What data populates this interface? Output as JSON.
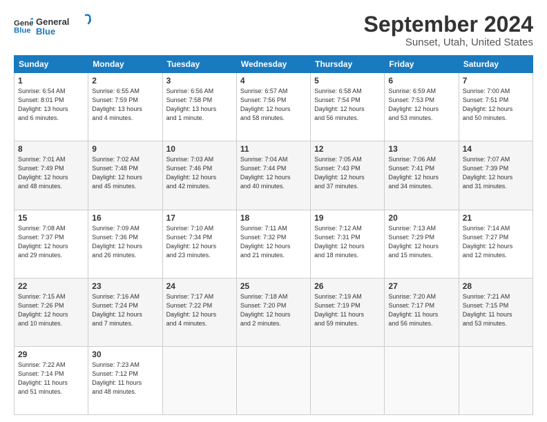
{
  "header": {
    "logo_line1": "General",
    "logo_line2": "Blue",
    "month": "September 2024",
    "location": "Sunset, Utah, United States"
  },
  "weekdays": [
    "Sunday",
    "Monday",
    "Tuesday",
    "Wednesday",
    "Thursday",
    "Friday",
    "Saturday"
  ],
  "weeks": [
    [
      {
        "day": "1",
        "info": "Sunrise: 6:54 AM\nSunset: 8:01 PM\nDaylight: 13 hours\nand 6 minutes."
      },
      {
        "day": "2",
        "info": "Sunrise: 6:55 AM\nSunset: 7:59 PM\nDaylight: 13 hours\nand 4 minutes."
      },
      {
        "day": "3",
        "info": "Sunrise: 6:56 AM\nSunset: 7:58 PM\nDaylight: 13 hours\nand 1 minute."
      },
      {
        "day": "4",
        "info": "Sunrise: 6:57 AM\nSunset: 7:56 PM\nDaylight: 12 hours\nand 58 minutes."
      },
      {
        "day": "5",
        "info": "Sunrise: 6:58 AM\nSunset: 7:54 PM\nDaylight: 12 hours\nand 56 minutes."
      },
      {
        "day": "6",
        "info": "Sunrise: 6:59 AM\nSunset: 7:53 PM\nDaylight: 12 hours\nand 53 minutes."
      },
      {
        "day": "7",
        "info": "Sunrise: 7:00 AM\nSunset: 7:51 PM\nDaylight: 12 hours\nand 50 minutes."
      }
    ],
    [
      {
        "day": "8",
        "info": "Sunrise: 7:01 AM\nSunset: 7:49 PM\nDaylight: 12 hours\nand 48 minutes."
      },
      {
        "day": "9",
        "info": "Sunrise: 7:02 AM\nSunset: 7:48 PM\nDaylight: 12 hours\nand 45 minutes."
      },
      {
        "day": "10",
        "info": "Sunrise: 7:03 AM\nSunset: 7:46 PM\nDaylight: 12 hours\nand 42 minutes."
      },
      {
        "day": "11",
        "info": "Sunrise: 7:04 AM\nSunset: 7:44 PM\nDaylight: 12 hours\nand 40 minutes."
      },
      {
        "day": "12",
        "info": "Sunrise: 7:05 AM\nSunset: 7:43 PM\nDaylight: 12 hours\nand 37 minutes."
      },
      {
        "day": "13",
        "info": "Sunrise: 7:06 AM\nSunset: 7:41 PM\nDaylight: 12 hours\nand 34 minutes."
      },
      {
        "day": "14",
        "info": "Sunrise: 7:07 AM\nSunset: 7:39 PM\nDaylight: 12 hours\nand 31 minutes."
      }
    ],
    [
      {
        "day": "15",
        "info": "Sunrise: 7:08 AM\nSunset: 7:37 PM\nDaylight: 12 hours\nand 29 minutes."
      },
      {
        "day": "16",
        "info": "Sunrise: 7:09 AM\nSunset: 7:36 PM\nDaylight: 12 hours\nand 26 minutes."
      },
      {
        "day": "17",
        "info": "Sunrise: 7:10 AM\nSunset: 7:34 PM\nDaylight: 12 hours\nand 23 minutes."
      },
      {
        "day": "18",
        "info": "Sunrise: 7:11 AM\nSunset: 7:32 PM\nDaylight: 12 hours\nand 21 minutes."
      },
      {
        "day": "19",
        "info": "Sunrise: 7:12 AM\nSunset: 7:31 PM\nDaylight: 12 hours\nand 18 minutes."
      },
      {
        "day": "20",
        "info": "Sunrise: 7:13 AM\nSunset: 7:29 PM\nDaylight: 12 hours\nand 15 minutes."
      },
      {
        "day": "21",
        "info": "Sunrise: 7:14 AM\nSunset: 7:27 PM\nDaylight: 12 hours\nand 12 minutes."
      }
    ],
    [
      {
        "day": "22",
        "info": "Sunrise: 7:15 AM\nSunset: 7:26 PM\nDaylight: 12 hours\nand 10 minutes."
      },
      {
        "day": "23",
        "info": "Sunrise: 7:16 AM\nSunset: 7:24 PM\nDaylight: 12 hours\nand 7 minutes."
      },
      {
        "day": "24",
        "info": "Sunrise: 7:17 AM\nSunset: 7:22 PM\nDaylight: 12 hours\nand 4 minutes."
      },
      {
        "day": "25",
        "info": "Sunrise: 7:18 AM\nSunset: 7:20 PM\nDaylight: 12 hours\nand 2 minutes."
      },
      {
        "day": "26",
        "info": "Sunrise: 7:19 AM\nSunset: 7:19 PM\nDaylight: 11 hours\nand 59 minutes."
      },
      {
        "day": "27",
        "info": "Sunrise: 7:20 AM\nSunset: 7:17 PM\nDaylight: 11 hours\nand 56 minutes."
      },
      {
        "day": "28",
        "info": "Sunrise: 7:21 AM\nSunset: 7:15 PM\nDaylight: 11 hours\nand 53 minutes."
      }
    ],
    [
      {
        "day": "29",
        "info": "Sunrise: 7:22 AM\nSunset: 7:14 PM\nDaylight: 11 hours\nand 51 minutes."
      },
      {
        "day": "30",
        "info": "Sunrise: 7:23 AM\nSunset: 7:12 PM\nDaylight: 11 hours\nand 48 minutes."
      },
      {
        "day": "",
        "info": ""
      },
      {
        "day": "",
        "info": ""
      },
      {
        "day": "",
        "info": ""
      },
      {
        "day": "",
        "info": ""
      },
      {
        "day": "",
        "info": ""
      }
    ]
  ]
}
